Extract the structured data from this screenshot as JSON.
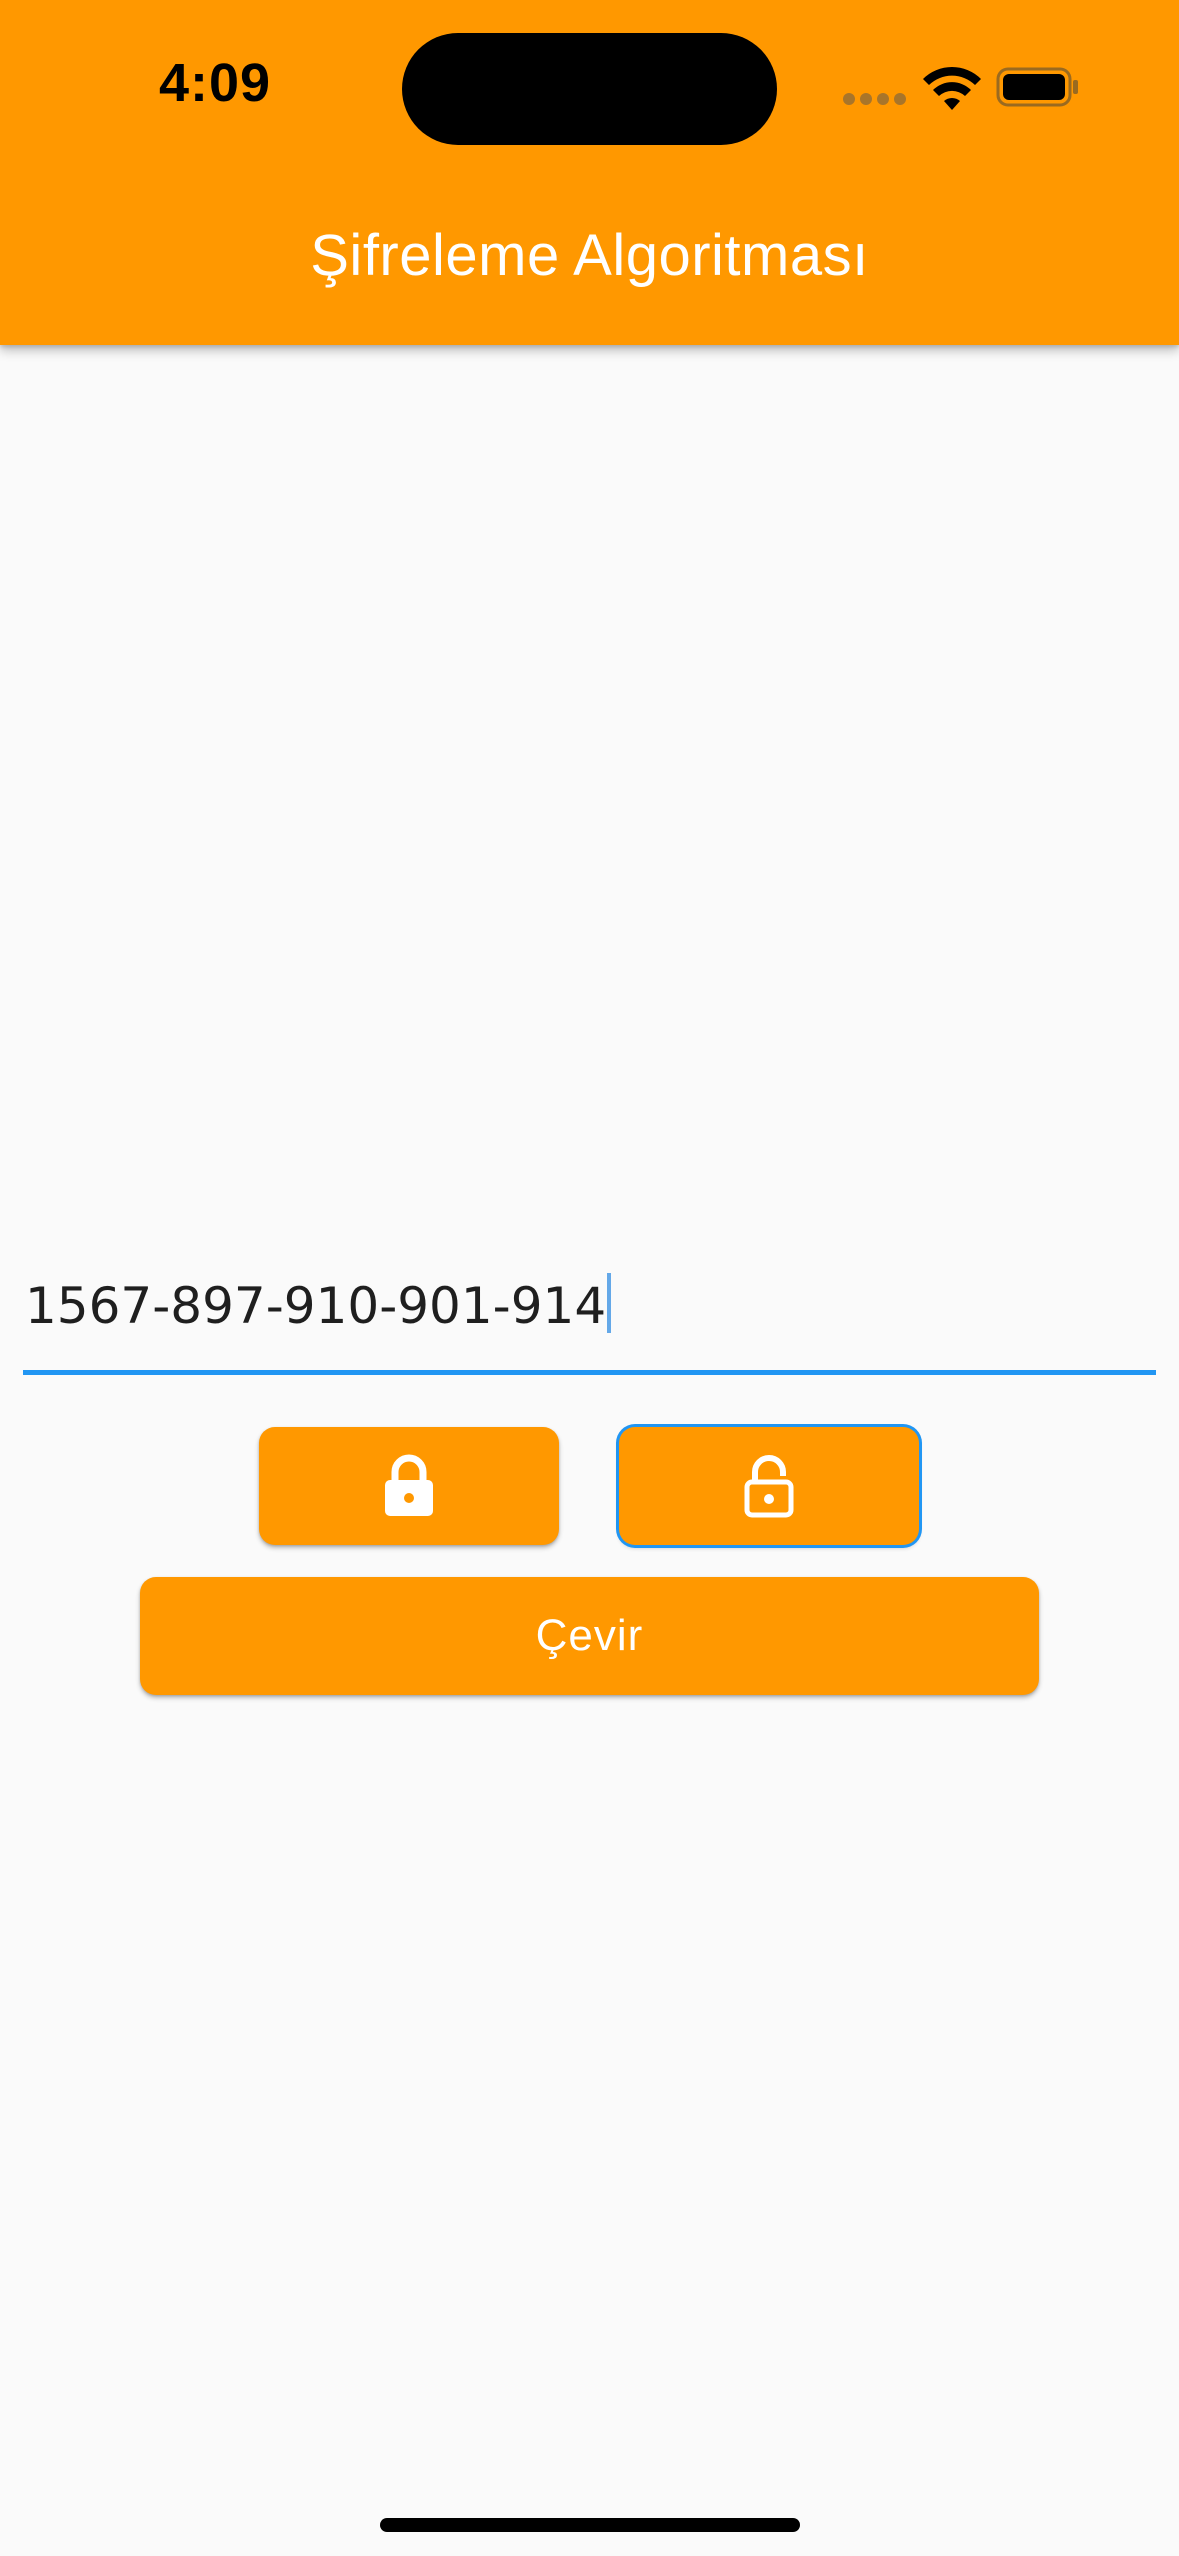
{
  "status_bar": {
    "time": "4:09"
  },
  "app_bar": {
    "title": "Şifreleme Algoritması",
    "background_color": "#ff9800",
    "title_color": "#ffffff"
  },
  "input": {
    "value": "1567-897-910-901-914",
    "underline_color": "#2196f3"
  },
  "buttons": {
    "encrypt_icon": "lock-icon",
    "decrypt_icon": "unlock-icon",
    "convert_label": "Çevir",
    "color": "#ff9800"
  }
}
